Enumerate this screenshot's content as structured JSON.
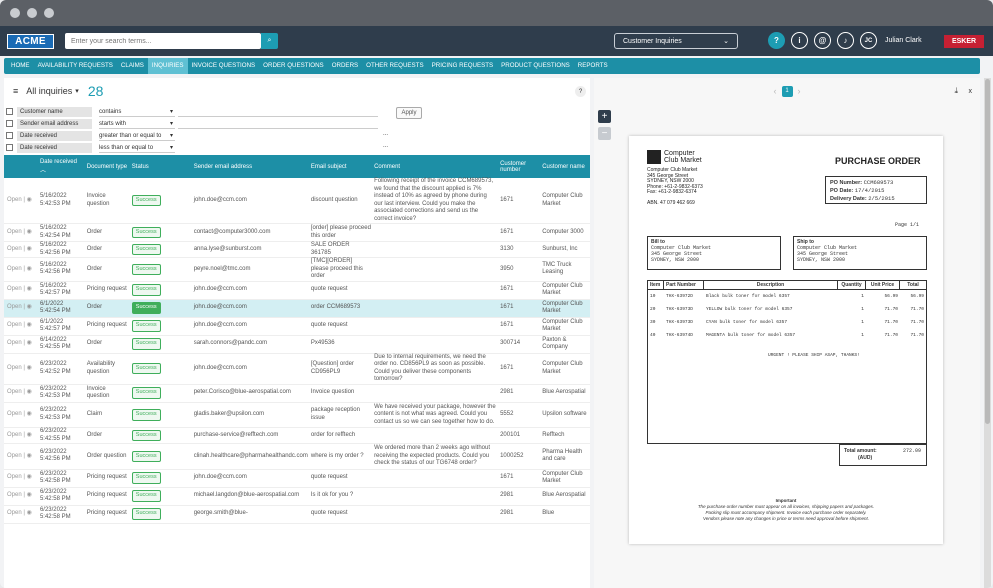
{
  "header": {
    "logo": "ACME",
    "search_placeholder": "Enter your search terms...",
    "dropdown": "Customer Inquiries",
    "user_initials": "JC",
    "user_name": "Julian Clark",
    "brand": "ESKER"
  },
  "nav": [
    "HOME",
    "AVAILABILITY REQUESTS",
    "CLAIMS",
    "INQUIRIES",
    "INVOICE QUESTIONS",
    "ORDER QUESTIONS",
    "ORDERS",
    "OTHER REQUESTS",
    "PRICING REQUESTS",
    "PRODUCT QUESTIONS",
    "REPORTS"
  ],
  "list": {
    "title": "All inquiries",
    "count": "28",
    "help": "?"
  },
  "filters": [
    {
      "field": "Customer name",
      "op": "contains",
      "value": ""
    },
    {
      "field": "Sender email address",
      "op": "starts with",
      "value": ""
    },
    {
      "field": "Date received",
      "op": "greater than or equal to",
      "value": "..."
    },
    {
      "field": "Date received",
      "op": "less than or equal to",
      "value": "..."
    }
  ],
  "apply": "Apply",
  "columns": [
    "Date received",
    "Document type",
    "Status",
    "Sender email address",
    "Email subject",
    "Comment",
    "Customer number",
    "Customer name"
  ],
  "rows": [
    {
      "open": "Open",
      "date": "5/16/2022 5:42:53 PM",
      "type": "Invoice question",
      "status": "Success",
      "email": "john.doe@ccm.com",
      "subject": "discount question",
      "comment": "Following receipt of the invoice CCM689573, we found that the discount applied is 7% instead of 10% as agreed by phone during our last interview. Could you make the associated corrections and send us the correct invoice?",
      "num": "1671",
      "name": "Computer Club Market"
    },
    {
      "open": "Open",
      "date": "5/16/2022 5:42:54 PM",
      "type": "Order",
      "status": "Success",
      "email": "contact@computer3000.com",
      "subject": "[order] please proceed this order",
      "comment": "",
      "num": "1671",
      "name": "Computer 3000"
    },
    {
      "open": "Open",
      "date": "5/16/2022 5:42:56 PM",
      "type": "Order",
      "status": "Success",
      "email": "anna.lyse@sunburst.com",
      "subject": "SALE ORDER 361785",
      "comment": "",
      "num": "3130",
      "name": "Sunburst, Inc"
    },
    {
      "open": "Open",
      "date": "5/16/2022 5:42:56 PM",
      "type": "Order",
      "status": "Success",
      "email": "peyre.noel@tmc.com",
      "subject": "[TMC][ORDER] please proceed this order",
      "comment": "",
      "num": "3950",
      "name": "TMC Truck Leasing"
    },
    {
      "open": "Open",
      "date": "5/16/2022 5:42:57 PM",
      "type": "Pricing request",
      "status": "Success",
      "email": "john.doe@ccm.com",
      "subject": "quote request",
      "comment": "",
      "num": "1671",
      "name": "Computer Club Market"
    },
    {
      "open": "Open",
      "date": "6/1/2022 5:42:54 PM",
      "type": "Order",
      "status": "Success",
      "email": "john.doe@ccm.com",
      "subject": "order CCM689573",
      "comment": "",
      "num": "1671",
      "name": "Computer Club Market",
      "hl": true
    },
    {
      "open": "Open",
      "date": "6/1/2022 5:42:57 PM",
      "type": "Pricing request",
      "status": "Success",
      "email": "john.doe@ccm.com",
      "subject": "quote request",
      "comment": "",
      "num": "1671",
      "name": "Computer Club Market"
    },
    {
      "open": "Open",
      "date": "6/14/2022 5:42:55 PM",
      "type": "Order",
      "status": "Success",
      "email": "sarah.connors@pandc.com",
      "subject": "Px49536",
      "comment": "",
      "num": "300714",
      "name": "Paxton & Company"
    },
    {
      "open": "Open",
      "date": "6/23/2022 5:42:52 PM",
      "type": "Availability question",
      "status": "Success",
      "email": "john.doe@ccm.com",
      "subject": "[Question] order CD956PL9",
      "comment": "Due to internal requirements, we need the order no. CD856PL9 as soon as possible. Could you deliver these components tomorrow?",
      "num": "1671",
      "name": "Computer Club Market"
    },
    {
      "open": "Open",
      "date": "6/23/2022 5:42:53 PM",
      "type": "Invoice question",
      "status": "Success",
      "email": "peter.Corisco@blue-aerospatial.com",
      "subject": "Invoice question",
      "comment": "",
      "num": "2981",
      "name": "Blue Aerospatial"
    },
    {
      "open": "Open",
      "date": "6/23/2022 5:42:53 PM",
      "type": "Claim",
      "status": "Success",
      "email": "gladis.baker@upsilon.com",
      "subject": "package reception issue",
      "comment": "We have received your package, however the content is not what was agreed. Could you contact us so we can see together how to do.",
      "num": "5552",
      "name": "Upsilon software"
    },
    {
      "open": "Open",
      "date": "6/23/2022 5:42:55 PM",
      "type": "Order",
      "status": "Success",
      "email": "purchase-service@refftech.com",
      "subject": "order for refftech",
      "comment": "",
      "num": "200101",
      "name": "Refftech"
    },
    {
      "open": "Open",
      "date": "6/23/2022 5:42:56 PM",
      "type": "Order question",
      "status": "Success",
      "email": "clinah.healthcare@pharmahealthandc.com",
      "subject": "where is my order ?",
      "comment": "We ordered more than 2 weeks ago without receiving the expected products. Could you check the status of our TG6748 order?",
      "num": "1000252",
      "name": "Pharma Health and care"
    },
    {
      "open": "Open",
      "date": "6/23/2022 5:42:58 PM",
      "type": "Pricing request",
      "status": "Success",
      "email": "john.doe@ccm.com",
      "subject": "quote request",
      "comment": "",
      "num": "1671",
      "name": "Computer Club Market"
    },
    {
      "open": "Open",
      "date": "6/23/2022 5:42:58 PM",
      "type": "Pricing request",
      "status": "Success",
      "email": "michael.langdon@blue-aerospatial.com",
      "subject": "Is it ok for you ?",
      "comment": "",
      "num": "2981",
      "name": "Blue Aerospatial"
    },
    {
      "open": "Open",
      "date": "6/23/2022 5:42:58 PM",
      "type": "Pricing request",
      "status": "Success",
      "email": "george.smith@blue-",
      "subject": "quote request",
      "comment": "",
      "num": "2981",
      "name": "Blue"
    }
  ],
  "preview": {
    "page": "1",
    "company": "Computer Club Market",
    "logo_l1": "Computer",
    "logo_l2": "Club Market",
    "address": [
      "Computer Club Market",
      "345 George Street",
      "SYDNEY, NSW 2000",
      "Phone: +61-2-9832-6373",
      "Fax: +61-2-9832-6374"
    ],
    "abn": "ABN. 47 079 462 669",
    "po_title": "PURCHASE ORDER",
    "po_number_label": "PO Number:",
    "po_number": "CCM689573",
    "po_date_label": "PO Date:",
    "po_date": "17/4/2015",
    "delivery_label": "Delivery Date:",
    "delivery": "2/5/2015",
    "page_no": "Page 1/1",
    "bill_to": "Bill to",
    "ship_to": "Ship to",
    "bill_lines": [
      "Computer Club Market",
      "345 George Street",
      "SYDNEY, NSW 2000"
    ],
    "ship_lines": [
      "Computer Club Market",
      "345 George Street",
      "SYDNEY, NSW 2000"
    ],
    "cols": [
      "Item",
      "Part Number",
      "Description",
      "Quantity",
      "Unit Price",
      "Total"
    ],
    "items": [
      {
        "item": "10",
        "part": "THX-63972D",
        "desc": "Black bulk toner for model 6357",
        "qty": "1",
        "price": "56.99",
        "total": "56.99"
      },
      {
        "item": "20",
        "part": "THX-63973D",
        "desc": "YELLOW bulk toner for model 6357",
        "qty": "1",
        "price": "71.70",
        "total": "71.70"
      },
      {
        "item": "30",
        "part": "THX-63973D",
        "desc": "CYAN bulk toner for model 6357",
        "qty": "1",
        "price": "71.70",
        "total": "71.70"
      },
      {
        "item": "40",
        "part": "THX-63974D",
        "desc": "MAGENTA bulk toner for model 6357",
        "qty": "1",
        "price": "71.70",
        "total": "71.70"
      }
    ],
    "urgent": "URGENT ! PLEASE SHIP ASAP, THANKS!",
    "total_label": "Total amount:",
    "total_unit": "(AUD)",
    "total": "272.09",
    "important": "Important",
    "notes": [
      "The purchase order number must appear on all invoices, shipping papers and packages.",
      "Packing slip must accompany shipment. Invoice each purchase order separately.",
      "Vendors please note any changes in price or terms need approval before shipment."
    ]
  }
}
